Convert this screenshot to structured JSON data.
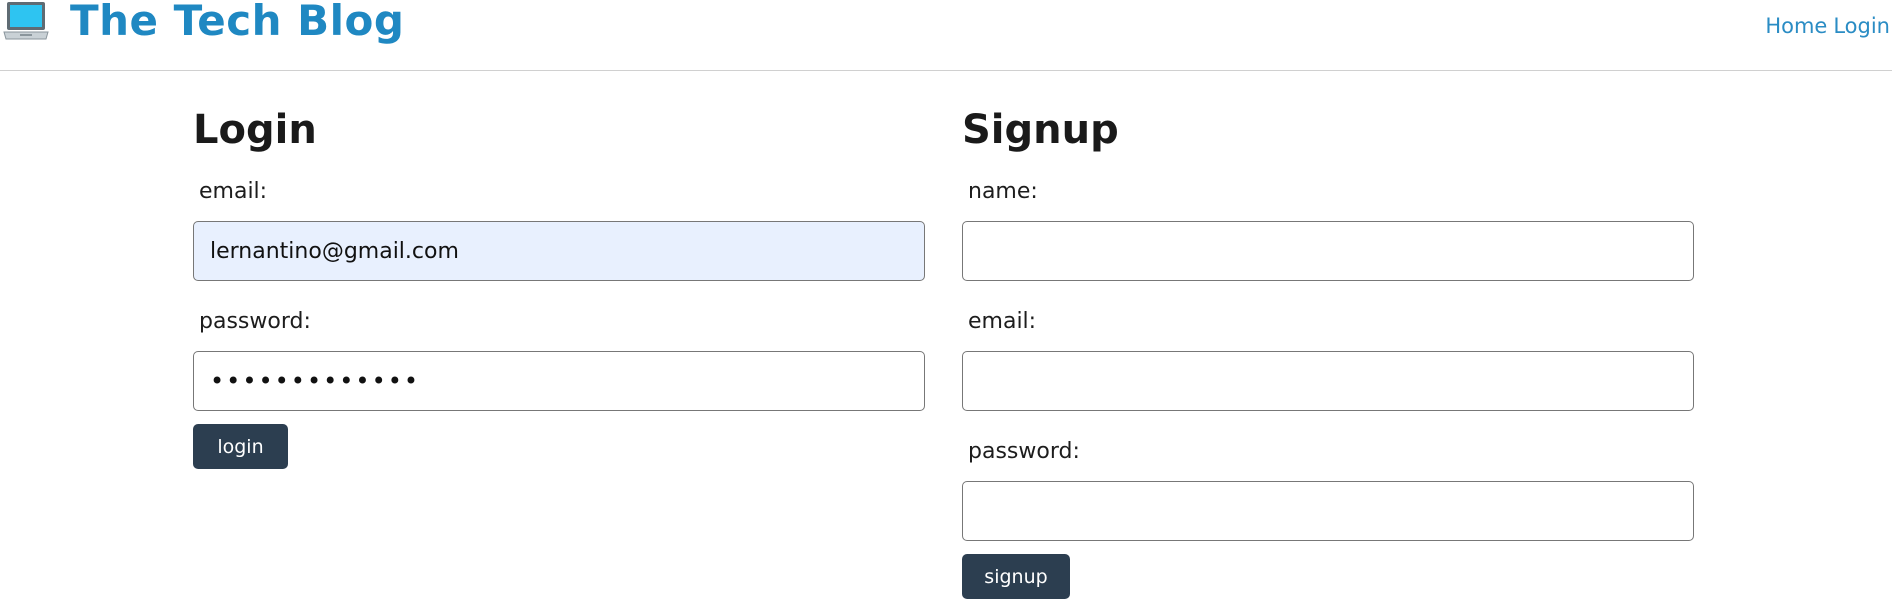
{
  "header": {
    "title": "The Tech Blog",
    "logo_icon": "laptop-icon",
    "nav": {
      "home": "Home",
      "login": "Login"
    },
    "brand_color": "#1f88c2"
  },
  "login": {
    "heading": "Login",
    "email_label": "email:",
    "email_value": "lernantino@gmail.com",
    "password_label": "password:",
    "password_value": "•••••••••••••",
    "button_label": "login"
  },
  "signup": {
    "heading": "Signup",
    "name_label": "name:",
    "name_value": "",
    "email_label": "email:",
    "email_value": "",
    "password_label": "password:",
    "password_value": "",
    "button_label": "signup"
  },
  "colors": {
    "button_bg": "#2c3e50",
    "autofill_bg": "#e8f0fe",
    "link": "#2a8cc4"
  }
}
